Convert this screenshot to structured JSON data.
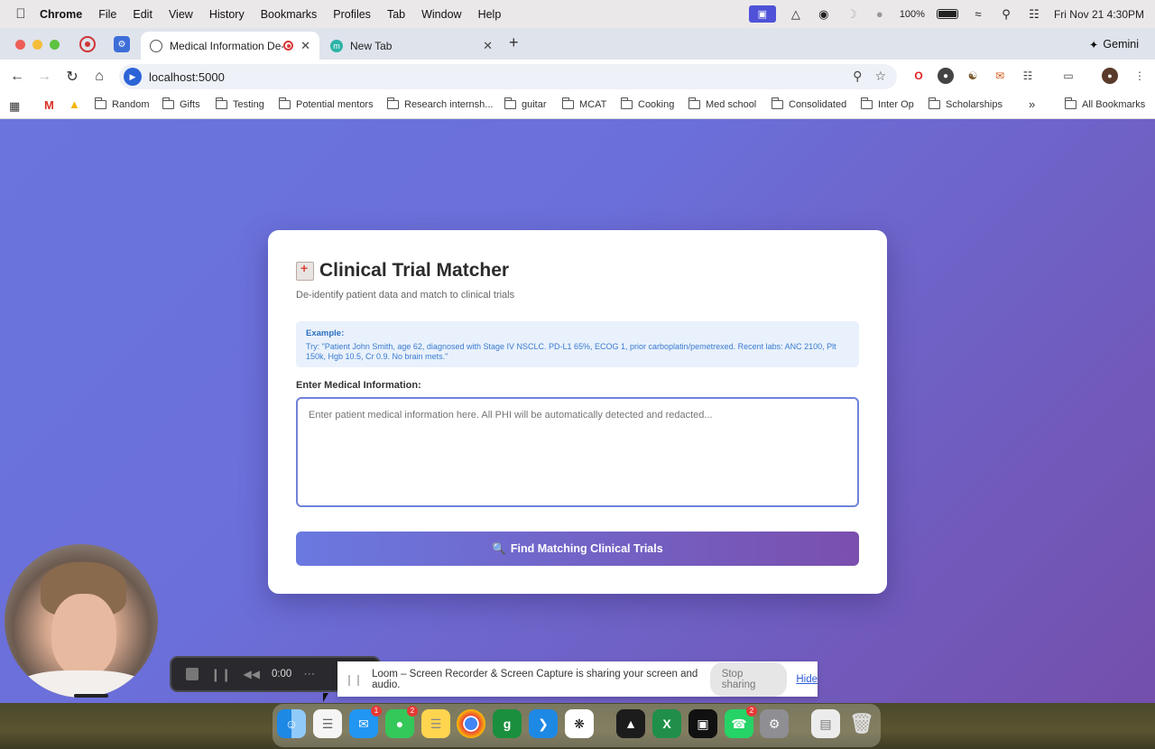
{
  "menubar": {
    "app": "Chrome",
    "items": [
      "File",
      "Edit",
      "View",
      "History",
      "Bookmarks",
      "Profiles",
      "Tab",
      "Window",
      "Help"
    ],
    "battery": "100%",
    "datetime": "Fri Nov 21  4:30PM"
  },
  "tabs": [
    {
      "title": "Medical Information De-id",
      "active": true
    },
    {
      "title": "New Tab",
      "active": false
    }
  ],
  "gemini_label": "Gemini",
  "address": {
    "url": "localhost:5000"
  },
  "bookmarks": [
    "Random",
    "Gifts",
    "Testing",
    "Potential mentors",
    "Research internsh...",
    "guitar",
    "MCAT",
    "Cooking",
    "Med school",
    "Consolidated",
    "Inter Op",
    "Scholarships"
  ],
  "all_bookmarks": "All Bookmarks",
  "app": {
    "title": "Clinical Trial Matcher",
    "subtitle": "De-identify patient data and match to clinical trials",
    "example_label": "Example:",
    "example_text": "Try: \"Patient John Smith, age 62, diagnosed with Stage IV NSCLC. PD-L1 65%, ECOG 1, prior carboplatin/pemetrexed. Recent labs: ANC 2100, Plt 150k, Hgb 10.5, Cr 0.9. No brain mets.\"",
    "input_label": "Enter Medical Information:",
    "input_placeholder": "Enter patient medical information here. All PHI will be automatically detected and redacted...",
    "input_value": "",
    "submit_label": "Find Matching Clinical Trials"
  },
  "loom": {
    "timer": "0:00",
    "share_message": "Loom – Screen Recorder & Screen Capture is sharing your screen and audio.",
    "stop_label": "Stop sharing",
    "hide_label": "Hide"
  },
  "dock": {
    "badges": {
      "mail": "1",
      "messages": "2",
      "whatsapp": "2"
    }
  },
  "colors": {
    "accent_start": "#6a79e0",
    "accent_end": "#7a4fae",
    "example_bg": "#e9f1fc",
    "example_text": "#3a7bd0"
  }
}
